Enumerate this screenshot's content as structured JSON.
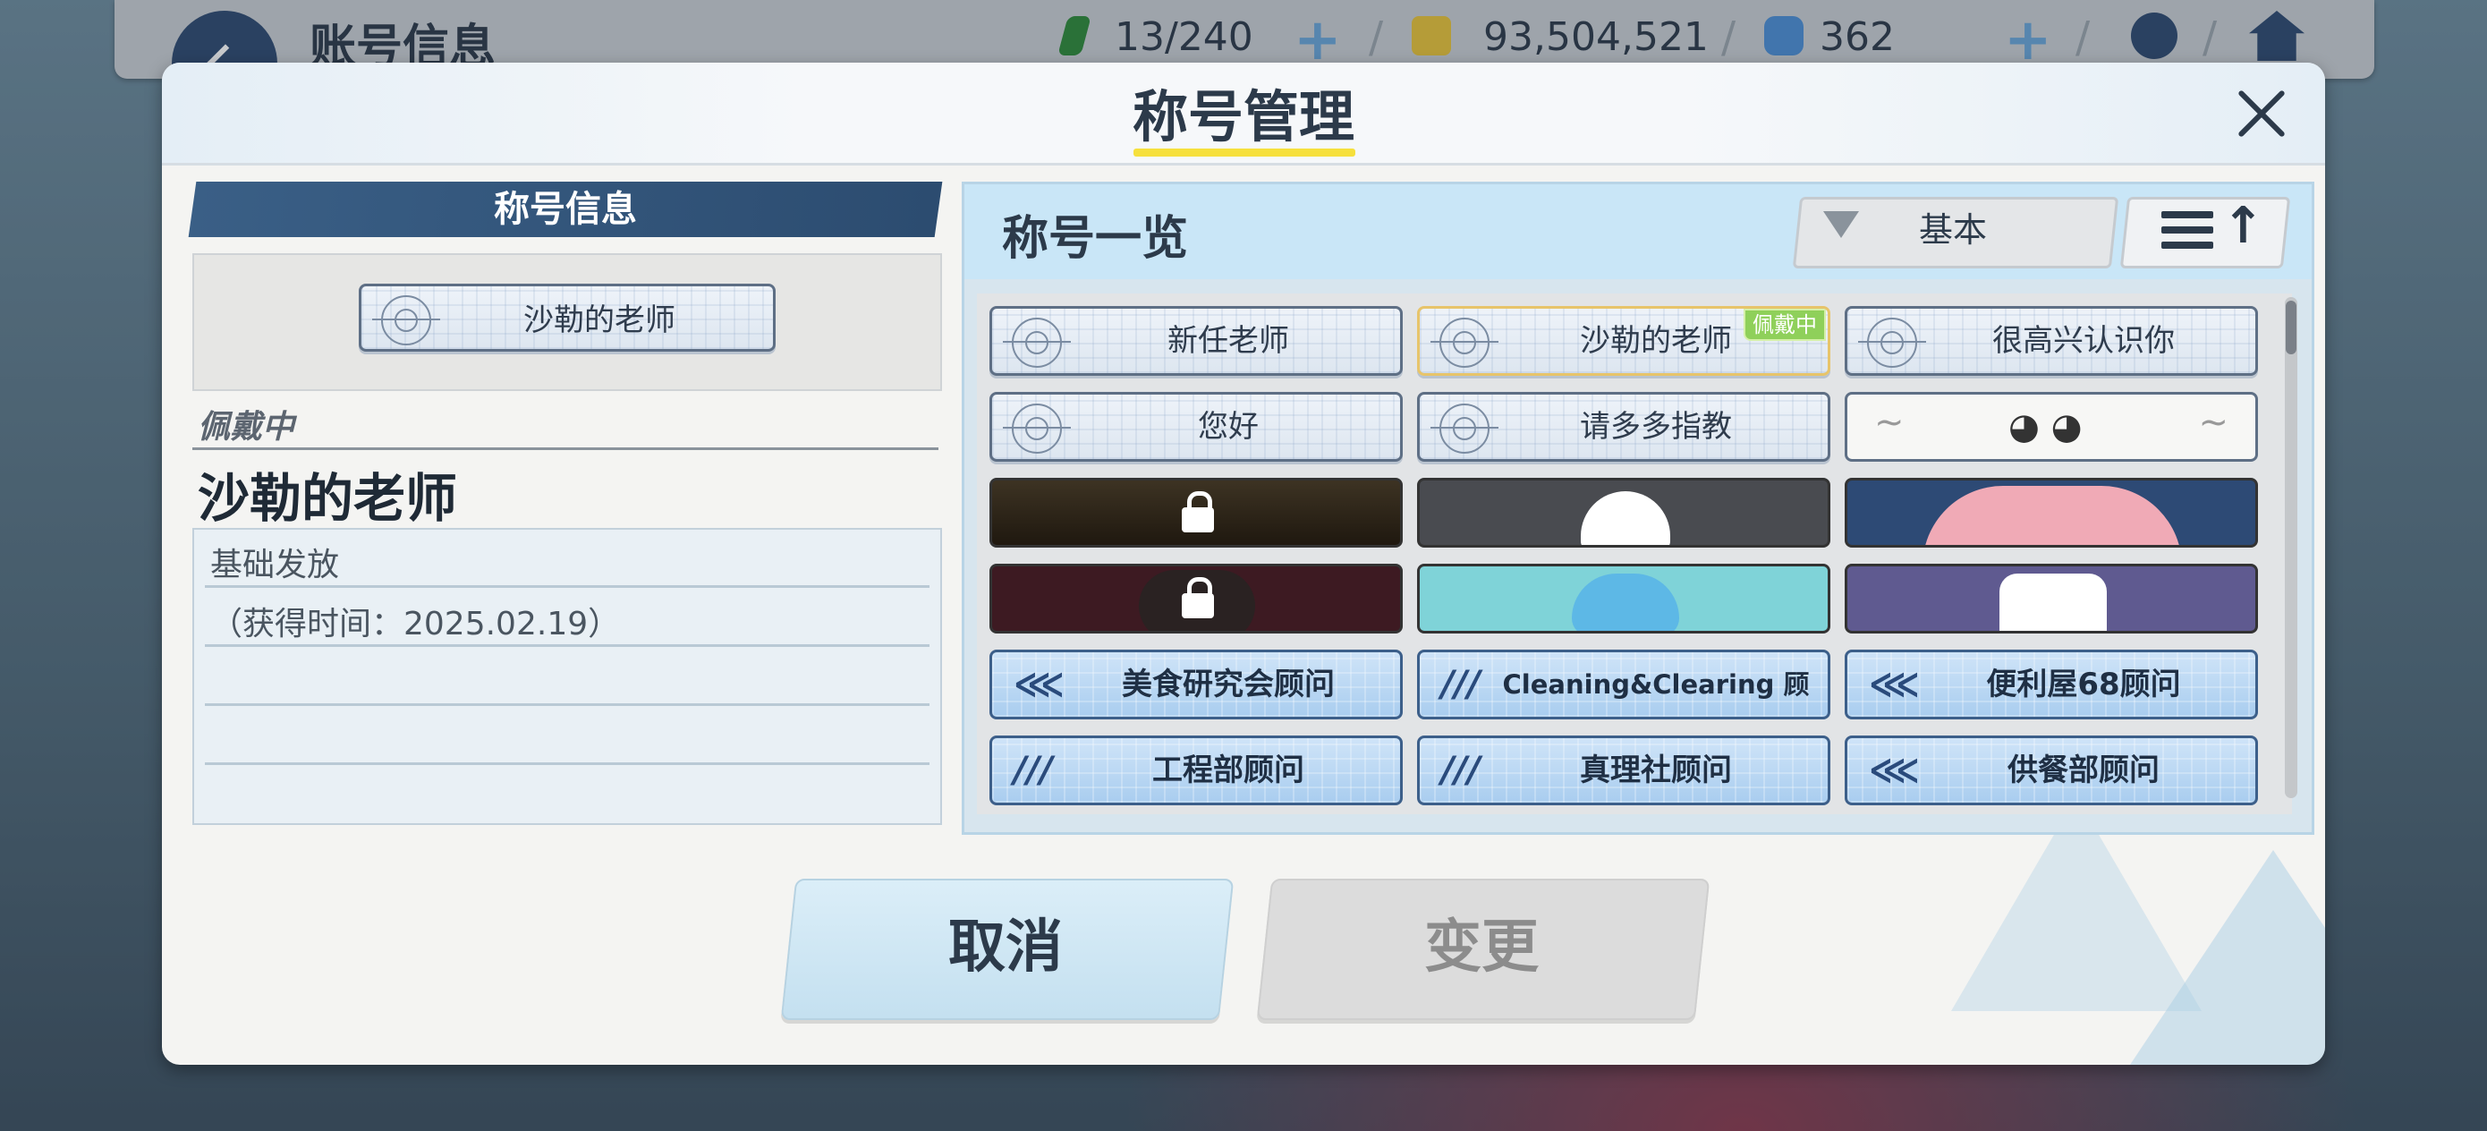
{
  "topbar": {
    "title": "账号信息",
    "stamina": "13/240",
    "credits": "93,504,521",
    "gems": "362"
  },
  "modal": {
    "title": "称号管理",
    "close_icon": "close-icon"
  },
  "info": {
    "header": "称号信息",
    "equipped_plate": "沙勒的老师",
    "wearing_label": "佩戴中",
    "wearing_name": "沙勒的老师",
    "source": "基础发放",
    "acquired": "（获得时间：2025.02.19）"
  },
  "list": {
    "title": "称号一览",
    "filter_label": "基本",
    "equipped_badge": "佩戴中",
    "items": [
      {
        "label": "新任老师",
        "kind": "plate"
      },
      {
        "label": "沙勒的老师",
        "kind": "plate",
        "equipped": true
      },
      {
        "label": "很高兴认识你",
        "kind": "plate"
      },
      {
        "label": "您好",
        "kind": "plate"
      },
      {
        "label": "请多多指教",
        "kind": "plate"
      },
      {
        "label": "",
        "kind": "sticker",
        "icon": "winged-face-icon"
      },
      {
        "label": "",
        "kind": "sticker",
        "icon": "locked-sticker-icon"
      },
      {
        "label": "",
        "kind": "sticker",
        "icon": "panda-sticker-icon"
      },
      {
        "label": "",
        "kind": "sticker",
        "icon": "pink-penguin-sticker-icon"
      },
      {
        "label": "",
        "kind": "sticker",
        "icon": "locked-sticker-icon"
      },
      {
        "label": "",
        "kind": "sticker",
        "icon": "blue-bird-sticker-icon"
      },
      {
        "label": "",
        "kind": "sticker",
        "icon": "cat-sticker-icon"
      },
      {
        "label": "美食研究会顾问",
        "kind": "club"
      },
      {
        "label": "Cleaning&Clearing 顾问",
        "kind": "club"
      },
      {
        "label": "便利屋68顾问",
        "kind": "club"
      },
      {
        "label": "工程部顾问",
        "kind": "club"
      },
      {
        "label": "真理社顾问",
        "kind": "club"
      },
      {
        "label": "供餐部顾问",
        "kind": "club"
      }
    ]
  },
  "buttons": {
    "cancel": "取消",
    "change": "变更"
  },
  "colors": {
    "accent_yellow": "#f6e03c",
    "navy_header": "#2c4c70",
    "equipped_badge": "#8fd05a"
  }
}
